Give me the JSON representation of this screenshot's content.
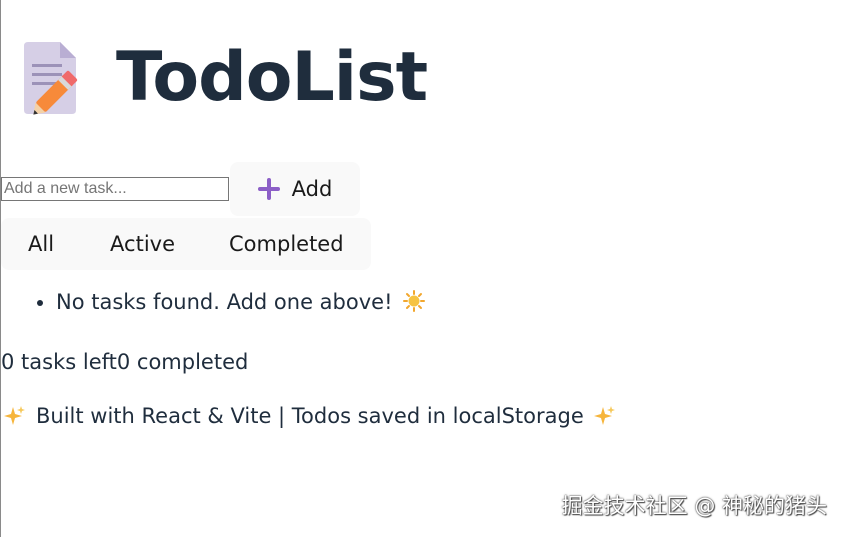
{
  "header": {
    "title": "TodoList",
    "logo_icon": "memo-pencil-icon"
  },
  "add_form": {
    "placeholder": "Add a new task...",
    "value": "",
    "add_label": "Add",
    "add_icon": "plus-icon",
    "accent_color": "#8c5fc7"
  },
  "filters": {
    "all_label": "All",
    "active_label": "Active",
    "completed_label": "Completed"
  },
  "task_list": {
    "empty_message": "No tasks found. Add one above!",
    "empty_icon": "sun-icon"
  },
  "stats": {
    "remaining": "0 tasks left",
    "completed": "0 completed"
  },
  "footer": {
    "text": "Built with React & Vite | Todos saved in localStorage",
    "icon": "sparkle-icon"
  },
  "watermark": {
    "text": "掘金技术社区 @ 神秘的猪头"
  }
}
